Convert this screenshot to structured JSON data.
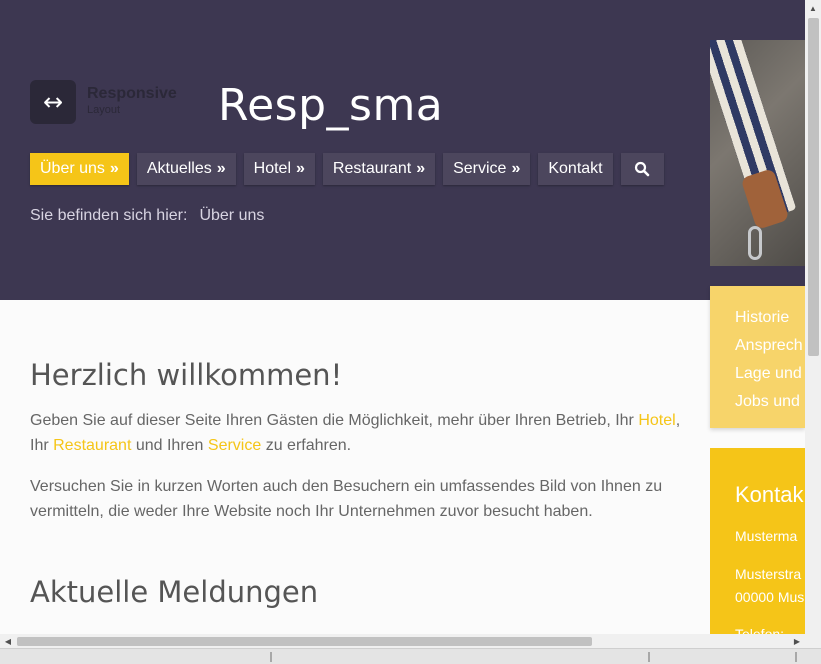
{
  "header": {
    "logo_icon": "horizontal-arrows-icon",
    "logo_icon_glyph": "↔",
    "logo_line1": "Responsive",
    "logo_line2": "Layout",
    "site_title": "Resp_sma",
    "background": "#3d3751"
  },
  "nav": {
    "items": [
      {
        "label": "Über uns",
        "chevron": "»",
        "active": true
      },
      {
        "label": "Aktuelles",
        "chevron": "»"
      },
      {
        "label": "Hotel",
        "chevron": "»"
      },
      {
        "label": "Restaurant",
        "chevron": "»"
      },
      {
        "label": "Service",
        "chevron": "»"
      },
      {
        "label": "Kontakt"
      }
    ],
    "search_icon": "search-icon",
    "accent": "#f5c518"
  },
  "breadcrumb": {
    "prefix": "Sie befinden sich hier:",
    "current": "Über uns"
  },
  "sidebar": {
    "links": [
      "Historie",
      "Ansprech",
      "Lage und",
      "Jobs und"
    ],
    "contact_title": "Kontak",
    "contact_lines": [
      "Musterma",
      "Musterstra",
      "00000 Mus",
      "Telefon: "
    ]
  },
  "main": {
    "heading": "Herzlich willkommen!",
    "p1_before": "Geben Sie auf dieser Seite Ihren Gästen die Möglichkeit, mehr über Ihren Betrieb, Ihr ",
    "p1_link1": "Hotel",
    "p1_mid1": ", Ihr ",
    "p1_link2": "Restaurant",
    "p1_mid2": " und Ihren ",
    "p1_link3": "Service",
    "p1_after": " zu erfahren.",
    "p2": "Versuchen Sie in kurzen Worten auch den Besuchern ein umfassendes Bild von Ihnen zu vermitteln, die weder Ihre Website noch Ihr Unternehmen zuvor besucht haben.",
    "heading2": "Aktuelle Meldungen"
  }
}
